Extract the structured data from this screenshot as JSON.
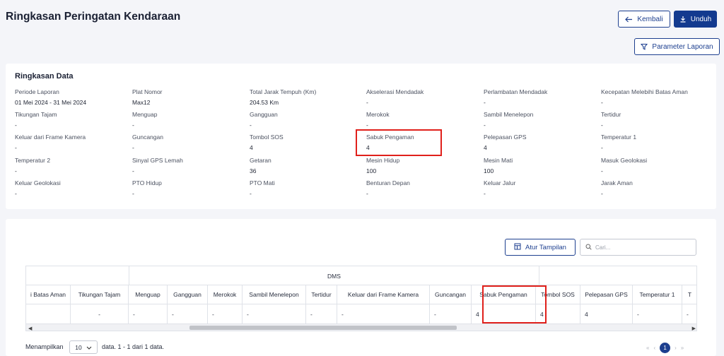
{
  "header": {
    "title": "Ringkasan Peringatan Kendaraan",
    "back_label": "Kembali",
    "download_label": "Unduh",
    "params_label": "Parameter Laporan"
  },
  "summary": {
    "title": "Ringkasan Data",
    "fields": [
      {
        "label": "Periode Laporan",
        "value": "01 Mei 2024 - 31 Mei 2024"
      },
      {
        "label": "Plat Nomor",
        "value": "Max12"
      },
      {
        "label": "Total Jarak Tempuh (Km)",
        "value": "204.53 Km"
      },
      {
        "label": "Akselerasi Mendadak",
        "value": "-"
      },
      {
        "label": "Perlambatan Mendadak",
        "value": "-"
      },
      {
        "label": "Kecepatan Melebihi Batas Aman",
        "value": "-"
      },
      {
        "label": "Tikungan Tajam",
        "value": "-"
      },
      {
        "label": "Menguap",
        "value": "-"
      },
      {
        "label": "Gangguan",
        "value": "-"
      },
      {
        "label": "Merokok",
        "value": "-"
      },
      {
        "label": "Sambil Menelepon",
        "value": "-"
      },
      {
        "label": "Tertidur",
        "value": "-"
      },
      {
        "label": "Keluar dari Frame Kamera",
        "value": "-"
      },
      {
        "label": "Guncangan",
        "value": "-"
      },
      {
        "label": "Tombol SOS",
        "value": "4"
      },
      {
        "label": "Sabuk Pengaman",
        "value": "4"
      },
      {
        "label": "Pelepasan GPS",
        "value": "4"
      },
      {
        "label": "Temperatur 1",
        "value": "-"
      },
      {
        "label": "Temperatur 2",
        "value": "-"
      },
      {
        "label": "Sinyal GPS Lemah",
        "value": "-"
      },
      {
        "label": "Getaran",
        "value": "36"
      },
      {
        "label": "Mesin Hidup",
        "value": "100"
      },
      {
        "label": "Mesin Mati",
        "value": "100"
      },
      {
        "label": "Masuk Geolokasi",
        "value": "-"
      },
      {
        "label": "Keluar Geolokasi",
        "value": "-"
      },
      {
        "label": "PTO Hidup",
        "value": "-"
      },
      {
        "label": "PTO Mati",
        "value": "-"
      },
      {
        "label": "Benturan Depan",
        "value": "-"
      },
      {
        "label": "Keluar Jalur",
        "value": "-"
      },
      {
        "label": "Jarak Aman",
        "value": "-"
      }
    ]
  },
  "table": {
    "view_label": "Atur Tampilan",
    "search_placeholder": "Cari...",
    "group_label": "DMS",
    "columns": [
      {
        "header": "i Batas Aman",
        "value": ""
      },
      {
        "header": "Tikungan Tajam",
        "value": "-"
      },
      {
        "header": "Menguap",
        "value": "-"
      },
      {
        "header": "Gangguan",
        "value": "-"
      },
      {
        "header": "Merokok",
        "value": "-"
      },
      {
        "header": "Sambil Menelepon",
        "value": "-"
      },
      {
        "header": "Tertidur",
        "value": "-"
      },
      {
        "header": "Keluar dari Frame Kamera",
        "value": "-"
      },
      {
        "header": "Guncangan",
        "value": "-"
      },
      {
        "header": "Sabuk Pengaman",
        "value": "4"
      },
      {
        "header": "Tombol SOS",
        "value": "4"
      },
      {
        "header": "Pelepasan GPS",
        "value": "4"
      },
      {
        "header": "Temperatur 1",
        "value": "-"
      },
      {
        "header": "T",
        "value": "-"
      }
    ]
  },
  "pagination": {
    "show_label": "Menampilkan",
    "page_size": "10",
    "info": "data.  1 - 1 dari 1 data.",
    "current_page": "1"
  },
  "colors": {
    "primary": "#133a8f",
    "highlight": "#e0201b"
  }
}
